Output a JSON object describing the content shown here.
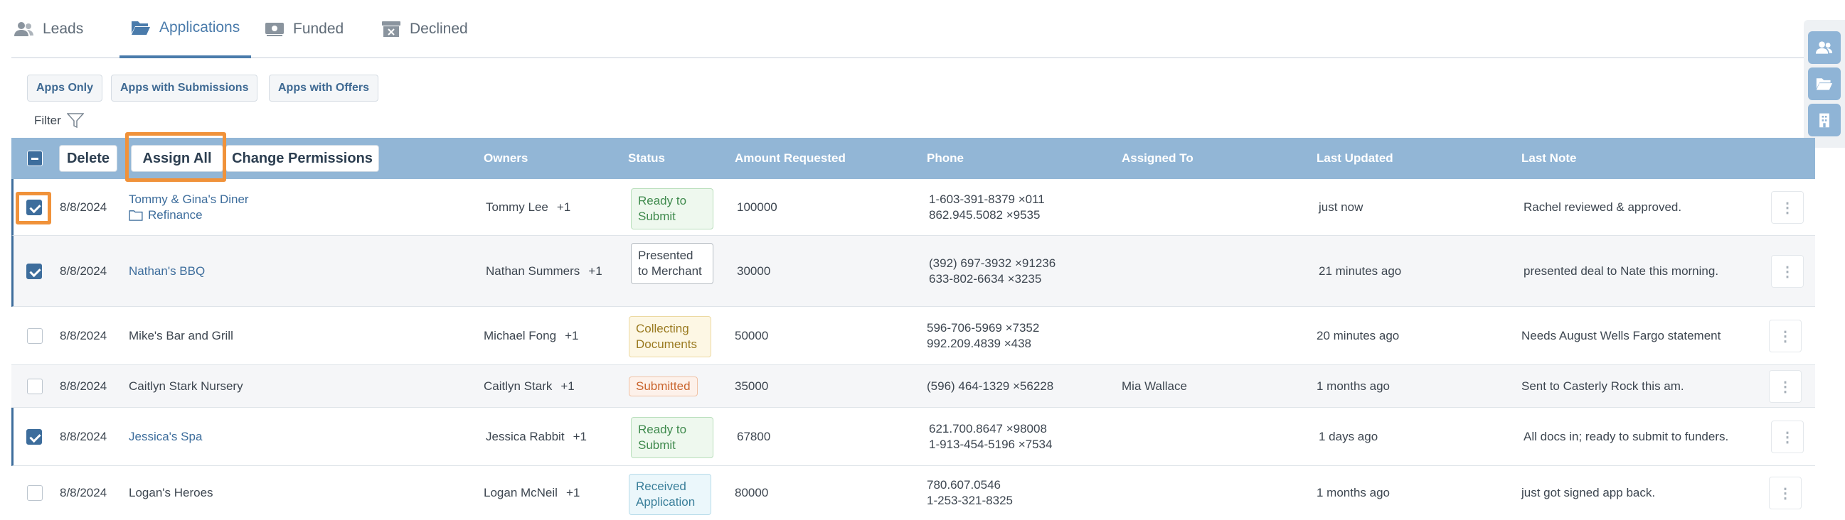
{
  "tabs": [
    {
      "label": "Leads",
      "icon": "users-icon"
    },
    {
      "label": "Applications",
      "icon": "folder-open-icon"
    },
    {
      "label": "Funded",
      "icon": "money-icon"
    },
    {
      "label": "Declined",
      "icon": "archive-x-icon"
    }
  ],
  "filters": {
    "apps_only": "Apps Only",
    "apps_with_submissions": "Apps with Submissions",
    "apps_with_offers": "Apps with Offers",
    "filter_label": "Filter"
  },
  "toolbar": {
    "delete": "Delete",
    "assign_all": "Assign All",
    "change_permissions": "Change Permissions"
  },
  "columns": {
    "owners": "Owners",
    "status": "Status",
    "amount": "Amount Requested",
    "phone": "Phone",
    "assigned": "Assigned To",
    "updated": "Last Updated",
    "note": "Last Note"
  },
  "rows": [
    {
      "date": "8/8/2024",
      "business": "Tommy & Gina's Diner",
      "sub": "Refinance",
      "owner": "Tommy Lee",
      "extra": "+1",
      "status": "Ready to Submit",
      "amount": "100000",
      "phone1": "1-603-391-8379 ×011",
      "phone2": "862.945.5082 ×9535",
      "assigned": "",
      "updated": "just now",
      "note": "Rachel reviewed & approved.",
      "checked": true
    },
    {
      "date": "8/8/2024",
      "business": "Nathan's BBQ",
      "owner": "Nathan Summers",
      "extra": "+1",
      "status": "Presented to Merchant",
      "amount": "30000",
      "phone1": "(392) 697-3932 ×91236",
      "phone2": "633-802-6634 ×3235",
      "assigned": "",
      "updated": "21 minutes ago",
      "note": "presented deal to Nate this morning.",
      "checked": true
    },
    {
      "date": "8/8/2024",
      "business": "Mike's Bar and Grill",
      "owner": "Michael Fong",
      "extra": "+1",
      "status": "Collecting Documents",
      "amount": "50000",
      "phone1": "596-706-5969 ×7352",
      "phone2": "992.209.4839 ×438",
      "assigned": "",
      "updated": "20 minutes ago",
      "note": "Needs August Wells Fargo statement",
      "checked": false
    },
    {
      "date": "8/8/2024",
      "business": "Caitlyn Stark Nursery",
      "owner": "Caitlyn Stark",
      "extra": "+1",
      "status": "Submitted",
      "amount": "35000",
      "phone1": "(596) 464-1329 ×56228",
      "phone2": "",
      "assigned": "Mia Wallace",
      "updated": "1 months ago",
      "note": "Sent to Casterly Rock this am.",
      "checked": false
    },
    {
      "date": "8/8/2024",
      "business": "Jessica's Spa",
      "owner": "Jessica Rabbit",
      "extra": "+1",
      "status": "Ready to Submit",
      "amount": "67800",
      "phone1": "621.700.8647 ×98008",
      "phone2": "1-913-454-5196 ×7534",
      "assigned": "",
      "updated": "1 days ago",
      "note": "All docs in; ready to submit to funders.",
      "checked": true
    },
    {
      "date": "8/8/2024",
      "business": "Logan's Heroes",
      "owner": "Logan McNeil",
      "extra": "+1",
      "status": "Received Application",
      "amount": "80000",
      "phone1": "780.607.0546",
      "phone2": "1-253-321-8325",
      "assigned": "",
      "updated": "1 months ago",
      "note": "just got signed app back.",
      "checked": false
    }
  ],
  "kebab_symbol": "⋮",
  "colors": {
    "accent": "#4a7bab",
    "header_bg": "#92b6d6",
    "highlight": "#f0923a"
  }
}
